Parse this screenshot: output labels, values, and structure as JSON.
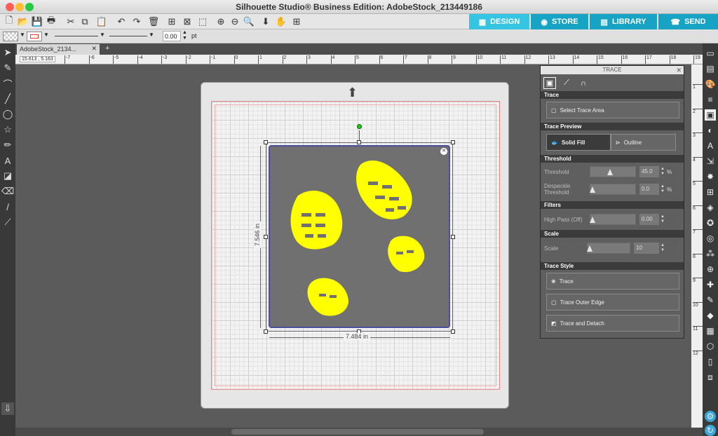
{
  "window": {
    "title": "Silhouette Studio® Business Edition: AdobeStock_213449186"
  },
  "modes": [
    {
      "label": "DESIGN",
      "icon": "grid-icon"
    },
    {
      "label": "STORE",
      "icon": "store-icon"
    },
    {
      "label": "LIBRARY",
      "icon": "library-icon"
    },
    {
      "label": "SEND",
      "icon": "send-icon"
    }
  ],
  "toolbar2": {
    "line_width": "0.00",
    "line_unit": "pt"
  },
  "document": {
    "tab": "AdobeStock_2134...",
    "add_tab": "+"
  },
  "rulers": {
    "coords": "15.613 , 5.163",
    "h_ticks": [
      "-7",
      "-6",
      "-5",
      "-4",
      "-3",
      "-2",
      "-1",
      "0",
      "1",
      "2",
      "3",
      "4",
      "5",
      "6",
      "7",
      "8",
      "9",
      "10",
      "11",
      "12",
      "13",
      "14",
      "15",
      "16",
      "17",
      "18",
      "19"
    ],
    "v_ticks": [
      "1",
      "2",
      "3",
      "4",
      "5",
      "6",
      "7",
      "8",
      "9",
      "10",
      "11",
      "12"
    ]
  },
  "selection": {
    "width": "7.484 in",
    "height": "7.546 in"
  },
  "panel": {
    "title": "TRACE",
    "sections": {
      "trace": "Trace",
      "preview": "Trace Preview",
      "threshold": "Threshold",
      "filters": "Filters",
      "scale": "Scale",
      "style": "Trace Style"
    },
    "select_trace_area": "Select Trace Area",
    "solid_fill": "Solid Fill",
    "outline": "Outline",
    "threshold_label": "Threshold",
    "threshold_value": "45.0",
    "threshold_unit": "%",
    "threshold_pct": 0.45,
    "despeckle_label_1": "Despeckle",
    "despeckle_label_2": "Threshold",
    "despeckle_value": "0.0",
    "despeckle_unit": "%",
    "highpass_label": "High Pass (Off)",
    "highpass_value": "0.00",
    "scale_label": "Scale",
    "scale_value": "10",
    "btn_trace": "Trace",
    "btn_trace_outer": "Trace Outer Edge",
    "btn_trace_detach": "Trace and Detach"
  },
  "colors": {
    "accent": "#35c5e2",
    "trace_fill": "#ffff00",
    "mat": "#e6e6e6"
  }
}
